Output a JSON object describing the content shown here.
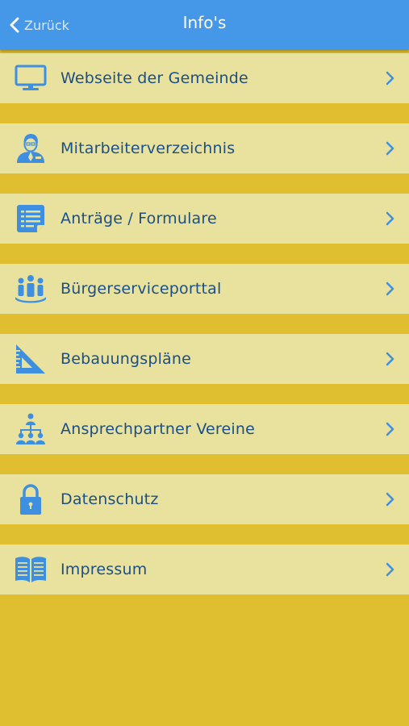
{
  "navbar": {
    "back_label": "Zurück",
    "title": "Info's",
    "color": "#4597e8"
  },
  "list": {
    "items": [
      {
        "label": "Webseite der Gemeinde",
        "icon": "monitor-icon"
      },
      {
        "label": "Mitarbeiterverzeichnis",
        "icon": "employee-icon"
      },
      {
        "label": "Anträge / Formulare",
        "icon": "form-icon"
      },
      {
        "label": "Bürgerserviceporttal",
        "icon": "citizens-group-icon"
      },
      {
        "label": "Bebauungspläne",
        "icon": "set-square-icon"
      },
      {
        "label": "Ansprechpartner Vereine",
        "icon": "org-chart-icon"
      },
      {
        "label": "Datenschutz",
        "icon": "padlock-icon"
      },
      {
        "label": "Impressum",
        "icon": "open-book-icon"
      }
    ]
  },
  "colors": {
    "background": "#dfbf2f",
    "row": "#e9e29f",
    "text": "#1c4f86",
    "icon": "#3f8fe0"
  }
}
